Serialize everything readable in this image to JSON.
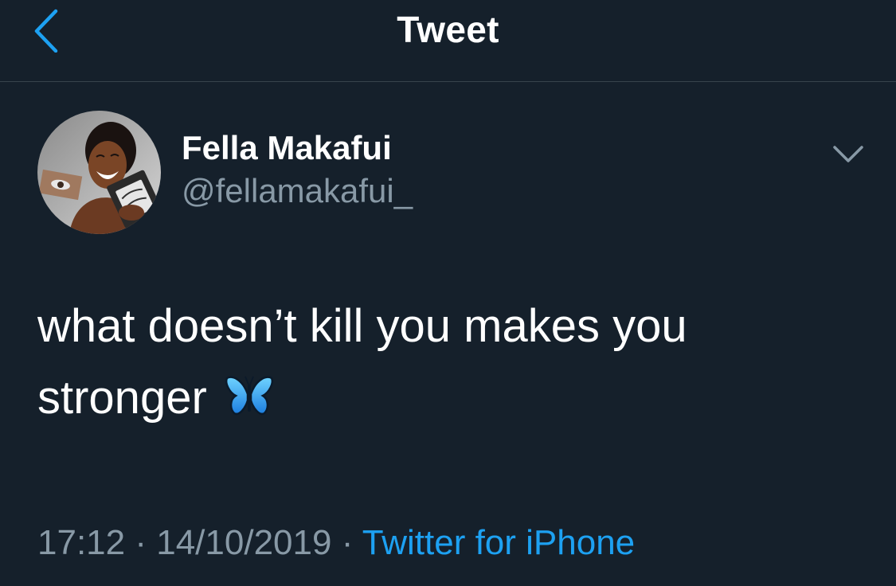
{
  "header": {
    "title": "Tweet",
    "back_icon": "chevron-left-icon"
  },
  "tweet": {
    "author": {
      "display_name": "Fella Makafui",
      "handle": "@fellamakafui_",
      "avatar_icon": "profile-photo"
    },
    "text_main": "what doesn’t kill you makes you stronger",
    "emoji": "butterfly-emoji",
    "time": "17:12",
    "separator": "·",
    "date": "14/10/2019",
    "source": "Twitter for iPhone",
    "menu_icon": "chevron-down-icon"
  },
  "colors": {
    "background": "#15202b",
    "accent": "#1da1f2",
    "secondary_text": "#8899a6",
    "divider": "#38444d"
  }
}
